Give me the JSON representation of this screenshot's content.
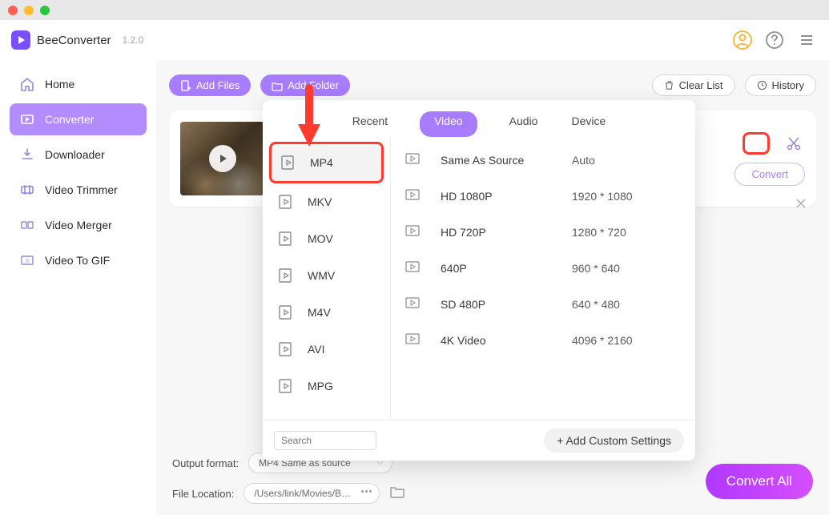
{
  "app": {
    "name": "BeeConverter",
    "version": "1.2.0"
  },
  "sidebar": {
    "items": [
      {
        "label": "Home"
      },
      {
        "label": "Converter"
      },
      {
        "label": "Downloader"
      },
      {
        "label": "Video Trimmer"
      },
      {
        "label": "Video Merger"
      },
      {
        "label": "Video To GIF"
      }
    ]
  },
  "toolbar": {
    "add_files": "Add Files",
    "add_folder": "Add Folder",
    "clear_list": "Clear List",
    "history": "History"
  },
  "card": {
    "convert": "Convert"
  },
  "dropdown": {
    "tabs": {
      "recent": "Recent",
      "video": "Video",
      "audio": "Audio",
      "device": "Device"
    },
    "formats": [
      "MP4",
      "MKV",
      "MOV",
      "WMV",
      "M4V",
      "AVI",
      "MPG"
    ],
    "resolutions": [
      {
        "name": "Same As Source",
        "dim": "Auto"
      },
      {
        "name": "HD 1080P",
        "dim": "1920 * 1080"
      },
      {
        "name": "HD 720P",
        "dim": "1280 * 720"
      },
      {
        "name": "640P",
        "dim": "960 * 640"
      },
      {
        "name": "SD 480P",
        "dim": "640 * 480"
      },
      {
        "name": "4K Video",
        "dim": "4096 * 2160"
      }
    ],
    "search_placeholder": "Search",
    "add_custom": "+ Add Custom Settings"
  },
  "bottom": {
    "output_format_label": "Output format:",
    "output_format_value": "MP4 Same as source",
    "file_location_label": "File Location:",
    "file_location_value": "/Users/link/Movies/BeeC",
    "convert_all": "Convert All"
  }
}
